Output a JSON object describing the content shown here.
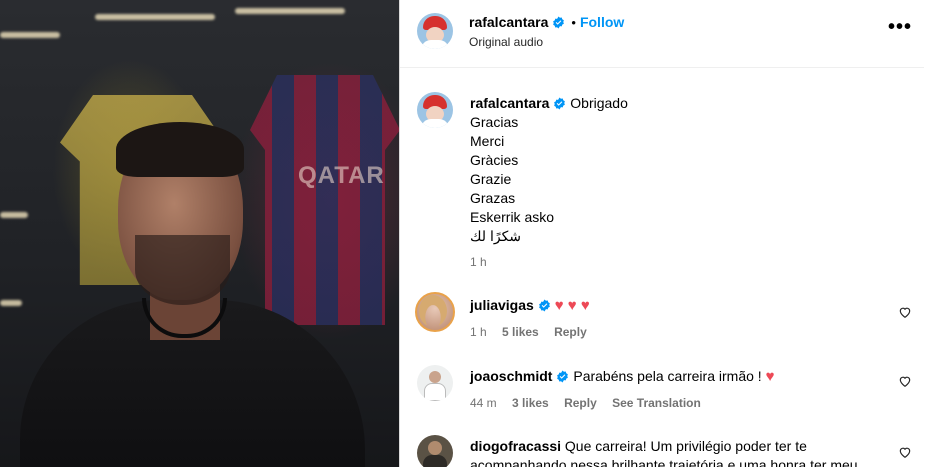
{
  "post": {
    "author": "rafalcantara",
    "follow_label": "Follow",
    "separator": "•",
    "subtitle": "Original audio",
    "more_label": "•••"
  },
  "caption": {
    "username": "rafalcantara",
    "lines": [
      "Obrigado",
      "Gracias",
      "Merci",
      "Gràcies",
      "Grazie",
      "Grazas",
      "Eskerrik asko",
      "شكرًا لك"
    ],
    "time": "1 h"
  },
  "comments": [
    {
      "username": "juliavigas",
      "text": "",
      "emoji": "♥ ♥ ♥",
      "time": "1 h",
      "likes": "5 likes",
      "reply": "Reply"
    },
    {
      "username": "joaoschmidt",
      "text": "Parabéns pela carreira irmão !",
      "emoji": "♥",
      "time": "44 m",
      "likes": "3 likes",
      "reply": "Reply",
      "translate": "See Translation"
    },
    {
      "username": "diogofracassi",
      "text": "Que carreira! Um privilégio poder ter te",
      "text2": "acompanhando nessa brilhante trajetória e uma honra ter meu"
    }
  ],
  "media": {
    "shirt_text": "QATAR"
  },
  "colors": {
    "accent": "#0095f6",
    "heart": "#ed4956",
    "verified": "#0095f6",
    "muted": "#737373"
  },
  "icons": [
    "verified-badge-icon",
    "heart-outline-icon",
    "more-options-icon"
  ]
}
